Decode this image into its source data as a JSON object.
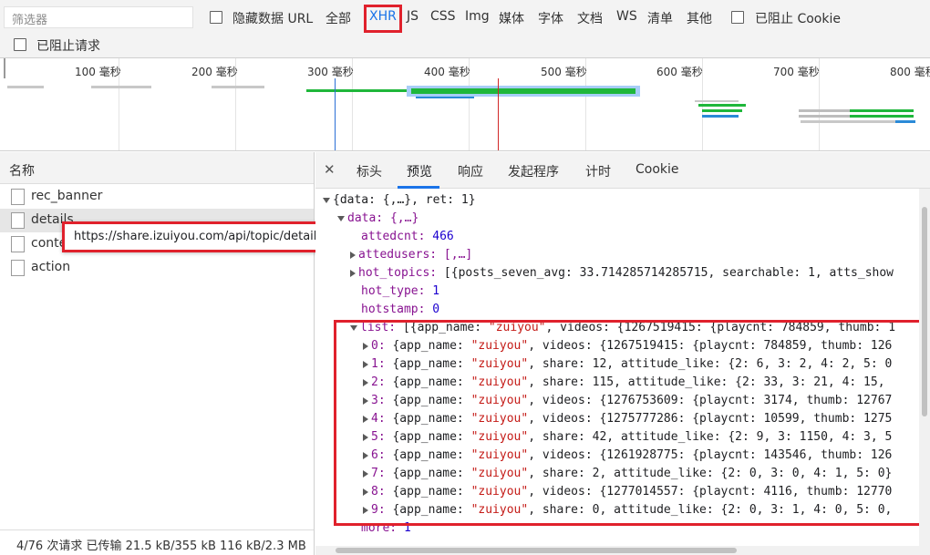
{
  "filter": {
    "placeholder": "筛选器",
    "hide_data_url": "隐藏数据 URL",
    "types": [
      "全部",
      "XHR",
      "JS",
      "CSS",
      "Img",
      "媒体",
      "字体",
      "文档",
      "WS",
      "清单",
      "其他"
    ],
    "blocked_cookie": "已阻止 Cookie",
    "blocked_requests": "已阻止请求",
    "selected_type": "XHR"
  },
  "overview": {
    "ticks": [
      "100 毫秒",
      "200 毫秒",
      "300 毫秒",
      "400 毫秒",
      "500 毫秒",
      "600 毫秒",
      "700 毫秒",
      "800 毫秒"
    ]
  },
  "names": {
    "header": "名称",
    "rows": [
      "rec_banner",
      "details",
      "conte",
      "action"
    ],
    "tooltip": "https://share.izuiyou.com/api/topic/details",
    "status": "4/76 次请求  已传输 21.5 kB/355 kB  116 kB/2.3 MB"
  },
  "tabs": {
    "items": [
      "标头",
      "预览",
      "响应",
      "发起程序",
      "计时",
      "Cookie"
    ],
    "active": "预览"
  },
  "json": {
    "root": "{data: {,…}, ret: 1}",
    "data": "data: {,…}",
    "attedcnt_key": "attedcnt:",
    "attedcnt_val": "466",
    "attedusers": "attedusers: [,…]",
    "hot_topics_key": "hot_topics:",
    "hot_topics_val": "[{posts_seven_avg: 33.714285714285715, searchable: 1, atts_show",
    "hot_type_key": "hot_type:",
    "hot_type_val": "1",
    "hotstamp_key": "hotstamp:",
    "hotstamp_val": "0",
    "list_key": "list:",
    "list_val": "[{app_name: \"zuiyou\", videos: {1267519415: {playcnt: 784859, thumb: 1",
    "items": [
      {
        "idx": "0:",
        "val": "{app_name: \"zuiyou\", videos: {1267519415: {playcnt: 784859, thumb: 126"
      },
      {
        "idx": "1:",
        "val": "{app_name: \"zuiyou\", share: 12, attitude_like: {2: 6, 3: 2, 4: 2, 5: 0"
      },
      {
        "idx": "2:",
        "val": "{app_name: \"zuiyou\", share: 115, attitude_like: {2: 33, 3: 21, 4: 15,"
      },
      {
        "idx": "3:",
        "val": "{app_name: \"zuiyou\", videos: {1276753609: {playcnt: 3174, thumb: 12767"
      },
      {
        "idx": "4:",
        "val": "{app_name: \"zuiyou\", videos: {1275777286: {playcnt: 10599, thumb: 1275"
      },
      {
        "idx": "5:",
        "val": "{app_name: \"zuiyou\", share: 42, attitude_like: {2: 9, 3: 1150, 4: 3, 5"
      },
      {
        "idx": "6:",
        "val": "{app_name: \"zuiyou\", videos: {1261928775: {playcnt: 143546, thumb: 126"
      },
      {
        "idx": "7:",
        "val": "{app_name: \"zuiyou\", share: 2, attitude_like: {2: 0, 3: 0, 4: 1, 5: 0}"
      },
      {
        "idx": "8:",
        "val": "{app_name: \"zuiyou\", videos: {1277014557: {playcnt: 4116, thumb: 12770"
      },
      {
        "idx": "9:",
        "val": "{app_name: \"zuiyou\", share: 0, attitude_like: {2: 0, 3: 1, 4: 0, 5: 0,"
      }
    ],
    "more_key": "more:",
    "more_val": "1"
  },
  "colors": {
    "highlight": "#e0212c",
    "accent": "#1a73e8",
    "json_key": "#881391",
    "json_string": "#c41a16",
    "json_number": "#1c00cf"
  }
}
